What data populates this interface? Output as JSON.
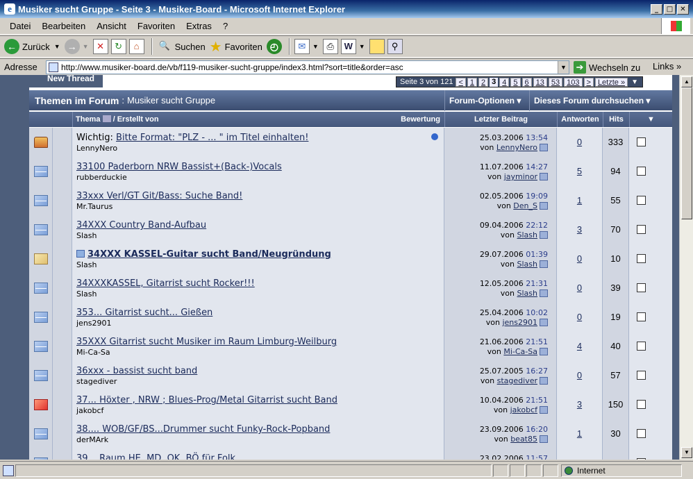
{
  "window": {
    "title": "Musiker sucht Gruppe - Seite 3 - Musiker-Board - Microsoft Internet Explorer"
  },
  "menu": [
    "Datei",
    "Bearbeiten",
    "Ansicht",
    "Favoriten",
    "Extras",
    "?"
  ],
  "toolbar": {
    "back": "Zurück",
    "search": "Suchen",
    "favorites": "Favoriten"
  },
  "address": {
    "label": "Adresse",
    "url": "http://www.musiker-board.de/vb/f119-musiker-sucht-gruppe/index3.html?sort=title&order=asc",
    "go": "Wechseln zu",
    "links": "Links"
  },
  "forum": {
    "new_thread": "New Thread",
    "pagenav": {
      "info": "Seite 3 von 121",
      "prev": "<",
      "pages": [
        "1",
        "2",
        "3",
        "4",
        "5",
        "6",
        "13",
        "53",
        "103"
      ],
      "current": "3",
      "next": ">",
      "last": "Letzte »"
    },
    "header": {
      "title": "Themen im Forum",
      "sep": ":",
      "forum_name": "Musiker sucht Gruppe",
      "options": "Forum-Optionen",
      "search": "Dieses Forum durchsuchen"
    },
    "columns": {
      "thema": "Thema",
      "by": "/ Erstellt von",
      "rating": "Bewertung",
      "last": "Letzter Beitrag",
      "answers": "Antworten",
      "hits": "Hits"
    },
    "threads": [
      {
        "icon": "lock",
        "prefix": "Wichtig: ",
        "title": "Bitte Format: \"PLZ - ... \" im Titel einhalten!",
        "author": "LennyNero",
        "date": "25.03.2006",
        "time": "13:54",
        "by_label": "von",
        "last": "LennyNero",
        "answers": "0",
        "hits": "333",
        "pinned": true
      },
      {
        "icon": "env",
        "prefix": "",
        "title": "33100 Paderborn NRW Bassist+(Back-)Vocals",
        "author": "rubberduckie",
        "date": "11.07.2006",
        "time": "14:27",
        "by_label": "von",
        "last": "jayminor",
        "answers": "5",
        "hits": "94"
      },
      {
        "icon": "env",
        "prefix": "",
        "title": "33xxx Verl/GT Git/Bass: Suche Band!",
        "author": "Mr.Taurus",
        "date": "02.05.2006",
        "time": "19:09",
        "by_label": "von",
        "last": "Den_S",
        "answers": "1",
        "hits": "55"
      },
      {
        "icon": "env",
        "prefix": "",
        "title": "34XXX Country Band-Aufbau",
        "author": "Slash",
        "date": "09.04.2006",
        "time": "22:12",
        "by_label": "von",
        "last": "Slash",
        "answers": "3",
        "hits": "70"
      },
      {
        "icon": "read",
        "prefix": "",
        "title": "34XXX KASSEL-Guitar sucht Band/Neugründung",
        "author": "Slash",
        "date": "29.07.2006",
        "time": "01:39",
        "by_label": "von",
        "last": "Slash",
        "answers": "0",
        "hits": "10",
        "bold": true
      },
      {
        "icon": "env",
        "prefix": "",
        "title": "34XXXKASSEL, Gitarrist sucht Rocker!!!",
        "author": "Slash",
        "date": "12.05.2006",
        "time": "21:31",
        "by_label": "von",
        "last": "Slash",
        "answers": "0",
        "hits": "39"
      },
      {
        "icon": "env",
        "prefix": "",
        "title": "353... Gitarrist sucht... Gießen",
        "author": "jens2901",
        "date": "25.04.2006",
        "time": "10:02",
        "by_label": "von",
        "last": "jens2901",
        "answers": "0",
        "hits": "19"
      },
      {
        "icon": "env",
        "prefix": "",
        "title": "35XXX Gitarrist sucht Musiker im Raum Limburg-Weilburg",
        "author": "Mi-Ca-Sa",
        "date": "21.06.2006",
        "time": "21:51",
        "by_label": "von",
        "last": "Mi-Ca-Sa",
        "answers": "4",
        "hits": "40"
      },
      {
        "icon": "env",
        "prefix": "",
        "title": "36xxx - bassist sucht band",
        "author": "stagediver",
        "date": "25.07.2005",
        "time": "16:27",
        "by_label": "von",
        "last": "stagediver",
        "answers": "0",
        "hits": "57"
      },
      {
        "icon": "hot",
        "prefix": "",
        "title": "37... Höxter , NRW ; Blues-Prog/Metal Gitarrist sucht Band",
        "author": "jakobcf",
        "date": "10.04.2006",
        "time": "21:51",
        "by_label": "von",
        "last": "jakobcf",
        "answers": "3",
        "hits": "150"
      },
      {
        "icon": "env",
        "prefix": "",
        "title": "38.... WOB/GF/BS...Drummer sucht Funky-Rock-Popband",
        "author": "derMArk",
        "date": "23.09.2006",
        "time": "16:20",
        "by_label": "von",
        "last": "beat85",
        "answers": "1",
        "hits": "30"
      },
      {
        "icon": "env",
        "prefix": "",
        "title": "39... Raum HE, MD, QK, BÖ für Folk",
        "author": "",
        "date": "23.02.2006",
        "time": "11:57",
        "by_label": "von",
        "last": "",
        "answers": "",
        "hits": ""
      }
    ]
  },
  "status": {
    "zone": "Internet"
  }
}
